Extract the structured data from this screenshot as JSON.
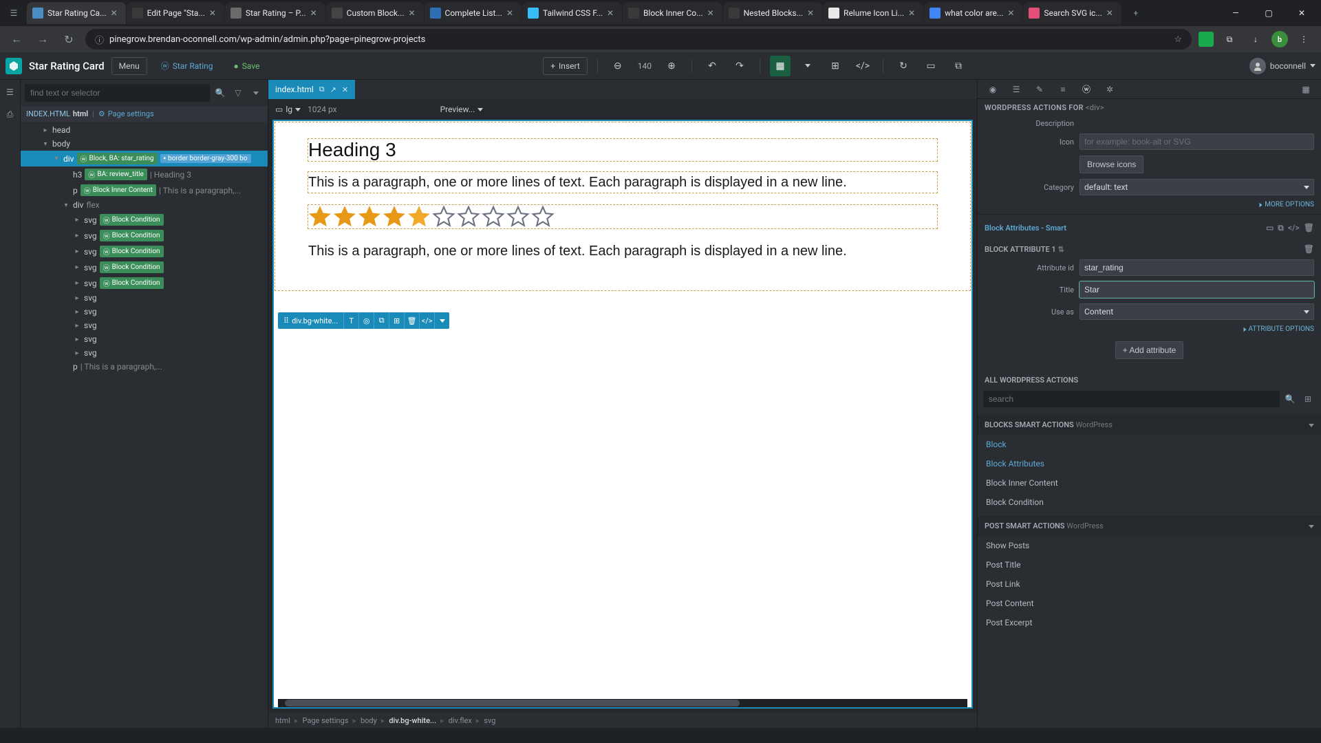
{
  "browser": {
    "tabs": [
      {
        "title": "Star Rating Ca...",
        "active": true,
        "favicon": "#4a8cc4"
      },
      {
        "title": "Edit Page \"Sta...",
        "favicon": "#3a3a3a"
      },
      {
        "title": "Star Rating – P...",
        "favicon": "#6a6a6a"
      },
      {
        "title": "Custom Block...",
        "favicon": "#444"
      },
      {
        "title": "Complete List...",
        "favicon": "#2e6eb5"
      },
      {
        "title": "Tailwind CSS F...",
        "favicon": "#38bdf8"
      },
      {
        "title": "Block Inner Co...",
        "favicon": "#3a3a3a"
      },
      {
        "title": "Nested Blocks...",
        "favicon": "#3a3a3a"
      },
      {
        "title": "Relume Icon Li...",
        "favicon": "#e8e8e8"
      },
      {
        "title": "what color are...",
        "favicon": "#4285f4"
      },
      {
        "title": "Search SVG ic...",
        "favicon": "#e34f79"
      }
    ],
    "url": "pinegrow.brendan-oconnell.com/wp-admin/admin.php?page=pinegrow-projects"
  },
  "topbar": {
    "project": "Star Rating Card",
    "menu": "Menu",
    "starRating": "Star Rating",
    "save": "Save",
    "insert": "Insert",
    "zoom": "140",
    "user": "boconnell"
  },
  "tree": {
    "searchPlaceholder": "find text or selector",
    "fileLabel": "INDEX.HTML",
    "fileBold": "html",
    "pageSettings": "Page settings",
    "nodes": {
      "head": "head",
      "body": "body",
      "divMain": "div",
      "divBadge1": "Block, BA: star_rating",
      "divBadge2": "border border-gray-300 bo",
      "h3": "h3",
      "h3Badge": "BA: review_title",
      "h3Text": "| Heading 3",
      "p1": "p",
      "p1Badge": "Block Inner Content",
      "p1Text": "| This is a paragraph,...",
      "divFlex": "div",
      "divFlexClass": "flex",
      "svg": "svg",
      "svgBadge": "Block Condition",
      "p2": "p",
      "p2Text": "| This is a paragraph,..."
    }
  },
  "canvas": {
    "tab": "index.html",
    "breakpoint": "lg",
    "width": "1024 px",
    "preview": "Preview...",
    "selLabel": "div.bg-white...",
    "heading": "Heading 3",
    "para1": "This is a paragraph, one or more lines of text. Each paragraph is displayed in a new line.",
    "para2": "This is a paragraph, one or more lines of text. Each paragraph is displayed in a new line.",
    "starsFilled": 5,
    "starsEmpty": 5,
    "crumbs": [
      "html",
      "Page settings",
      "body",
      "div.bg-white...",
      "div.flex",
      "svg"
    ]
  },
  "right": {
    "title": "WORDPRESS ACTIONS FOR",
    "titleToken": "<div>",
    "description": "Description",
    "iconLabel": "Icon",
    "iconPlaceholder": "for example: book-alt or SVG",
    "browseIcons": "Browse icons",
    "categoryLabel": "Category",
    "categoryValue": "default: text",
    "moreOptions": "MORE OPTIONS",
    "blockAttrSmart": "Block Attributes - Smart",
    "blockAttr1": "BLOCK ATTRIBUTE 1",
    "attrIdLabel": "Attribute id",
    "attrIdValue": "star_rating",
    "titleLabel": "Title",
    "titleValue": "Star",
    "useAsLabel": "Use as",
    "useAsValue": "Content",
    "attrOptions": "ATTRIBUTE OPTIONS",
    "addAttribute": "Add attribute",
    "allActions": "ALL WORDPRESS ACTIONS",
    "searchPlaceholder": "search",
    "blocksSmart": "BLOCKS SMART ACTIONS",
    "blocksSmartSuffix": "WordPress",
    "postSmart": "POST SMART ACTIONS",
    "postSmartSuffix": "WordPress",
    "actions": {
      "block": "Block",
      "blockAttributes": "Block Attributes",
      "blockInnerContent": "Block Inner Content",
      "blockCondition": "Block Condition",
      "showPosts": "Show Posts",
      "postTitle": "Post Title",
      "postLink": "Post Link",
      "postContent": "Post Content",
      "postExcerpt": "Post Excerpt"
    }
  }
}
